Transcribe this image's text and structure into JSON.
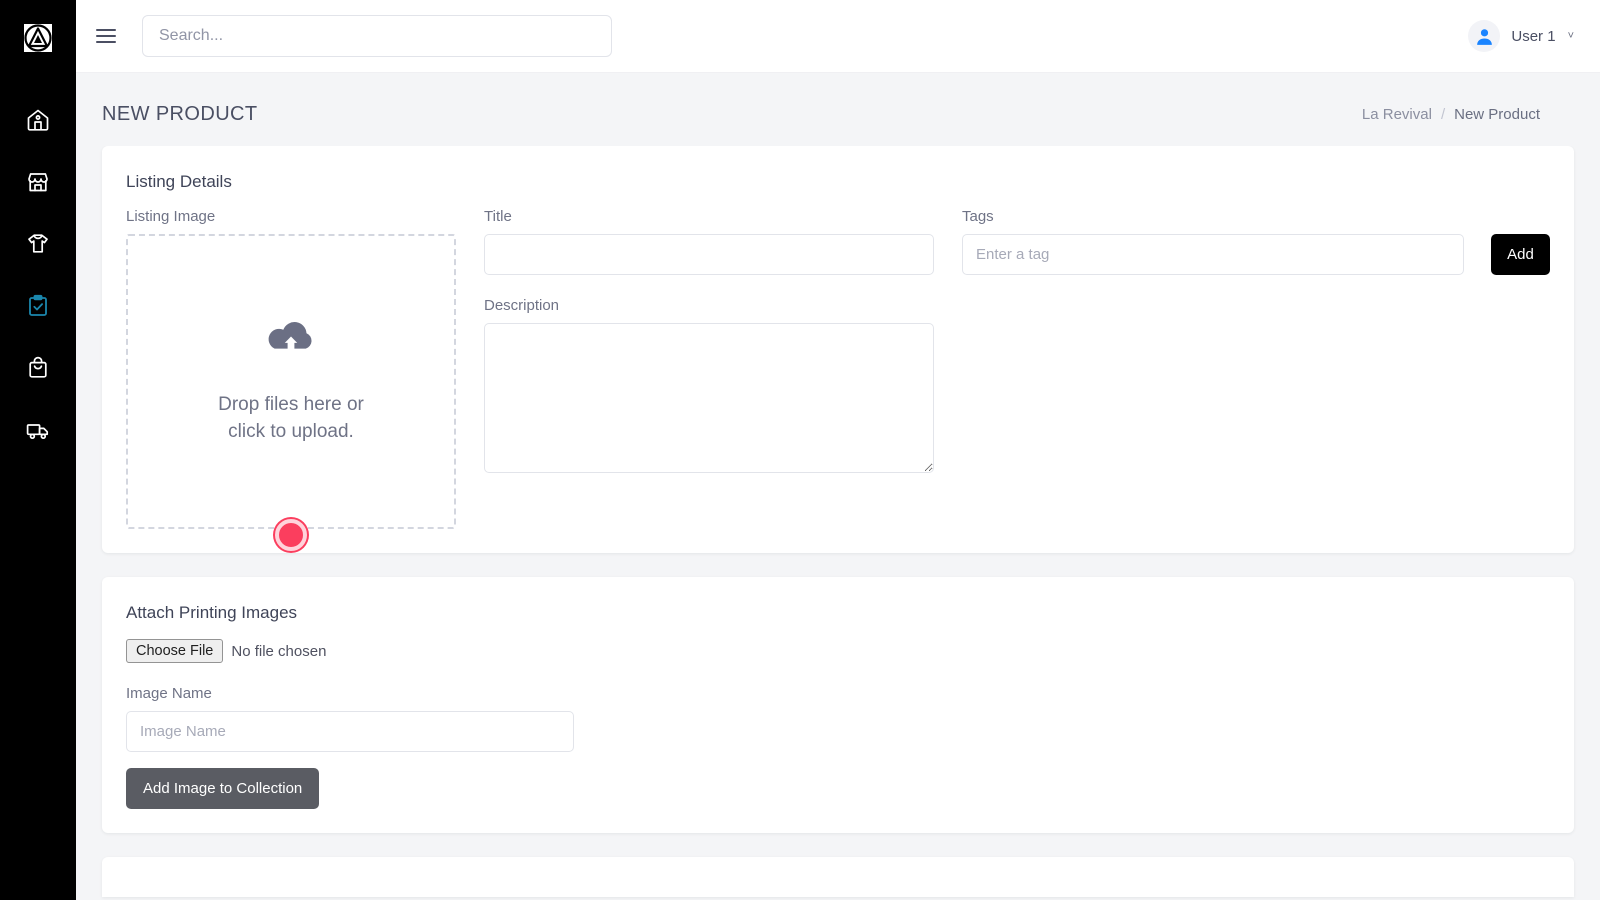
{
  "sidebar": {
    "logo_name": "triangle-logo",
    "items": [
      {
        "name": "home",
        "icon": "home-icon",
        "active": false
      },
      {
        "name": "store",
        "icon": "store-icon",
        "active": false
      },
      {
        "name": "apparel",
        "icon": "tshirt-icon",
        "active": false
      },
      {
        "name": "orders",
        "icon": "clipboard-check-icon",
        "active": true
      },
      {
        "name": "shop",
        "icon": "shopping-bag-icon",
        "active": false
      },
      {
        "name": "shipping",
        "icon": "delivery-truck-icon",
        "active": false
      }
    ],
    "active_color": "#1b87ad",
    "background": "#000000"
  },
  "topbar": {
    "menu_icon": "hamburger-icon",
    "search": {
      "value": "",
      "placeholder": "Search..."
    },
    "user": {
      "name": "User 1",
      "avatar_icon": "user-avatar-icon",
      "chevron": "˅",
      "avatar_color": "#1a84ff"
    }
  },
  "page": {
    "title": "NEW PRODUCT",
    "breadcrumb": {
      "parent": "La Revival",
      "separator": "/",
      "current": "New Product"
    }
  },
  "listing_details": {
    "card_title": "Listing Details",
    "image": {
      "label": "Listing Image",
      "upload_icon": "cloud-upload-icon",
      "drop_text_line1": "Drop files here or",
      "drop_text_line2": "click to upload."
    },
    "title_field": {
      "label": "Title",
      "value": "",
      "placeholder": ""
    },
    "description_field": {
      "label": "Description",
      "value": "",
      "placeholder": ""
    },
    "tags_field": {
      "label": "Tags",
      "value": "",
      "placeholder": "Enter a tag",
      "add_label": "Add"
    }
  },
  "attach_printing_images": {
    "card_title": "Attach Printing Images",
    "file_input": {
      "button_label": "Choose File",
      "status_text": "No file chosen"
    },
    "image_name": {
      "label": "Image Name",
      "value": "",
      "placeholder": "Image Name"
    },
    "add_button_label": "Add Image to Collection"
  },
  "cursor_marker": {
    "name": "click-marker",
    "color": "#fb3e5e"
  }
}
